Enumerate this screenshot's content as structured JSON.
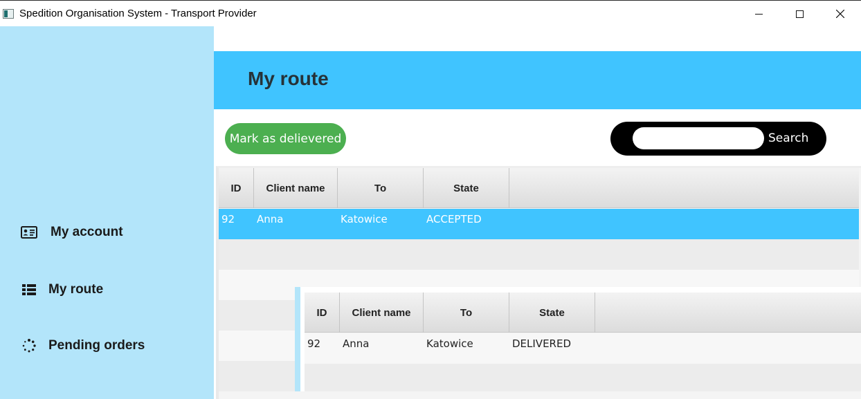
{
  "window": {
    "title": "Spedition Organisation System - Transport Provider",
    "controls": [
      "minimize",
      "maximize",
      "close"
    ]
  },
  "sidebar": {
    "items": [
      {
        "label": "My account",
        "icon": "id-card-icon"
      },
      {
        "label": "My route",
        "icon": "list-icon"
      },
      {
        "label": "Pending orders",
        "icon": "spinner-icon"
      }
    ]
  },
  "header": {
    "title": "My route"
  },
  "toolbar": {
    "mark_delivered_label": "Mark as delievered",
    "search": {
      "value": "",
      "placeholder": "",
      "button_label": "Search"
    }
  },
  "routes_table": {
    "columns": [
      "ID",
      "Client name",
      "To",
      "State"
    ],
    "rows": [
      {
        "id": "92",
        "client": "Anna",
        "to": "Katowice",
        "state": "ACCEPTED",
        "selected": true
      }
    ]
  },
  "detail_table": {
    "columns": [
      "ID",
      "Client name",
      "To",
      "State"
    ],
    "rows": [
      {
        "id": "92",
        "client": "Anna",
        "to": "Katowice",
        "state": "DELIVERED"
      }
    ]
  },
  "colors": {
    "sidebar": "#b3e5fa",
    "header": "#40c4ff",
    "selected_row": "#40c4ff",
    "mark_button": "#4caf50",
    "search_box": "#000000"
  }
}
